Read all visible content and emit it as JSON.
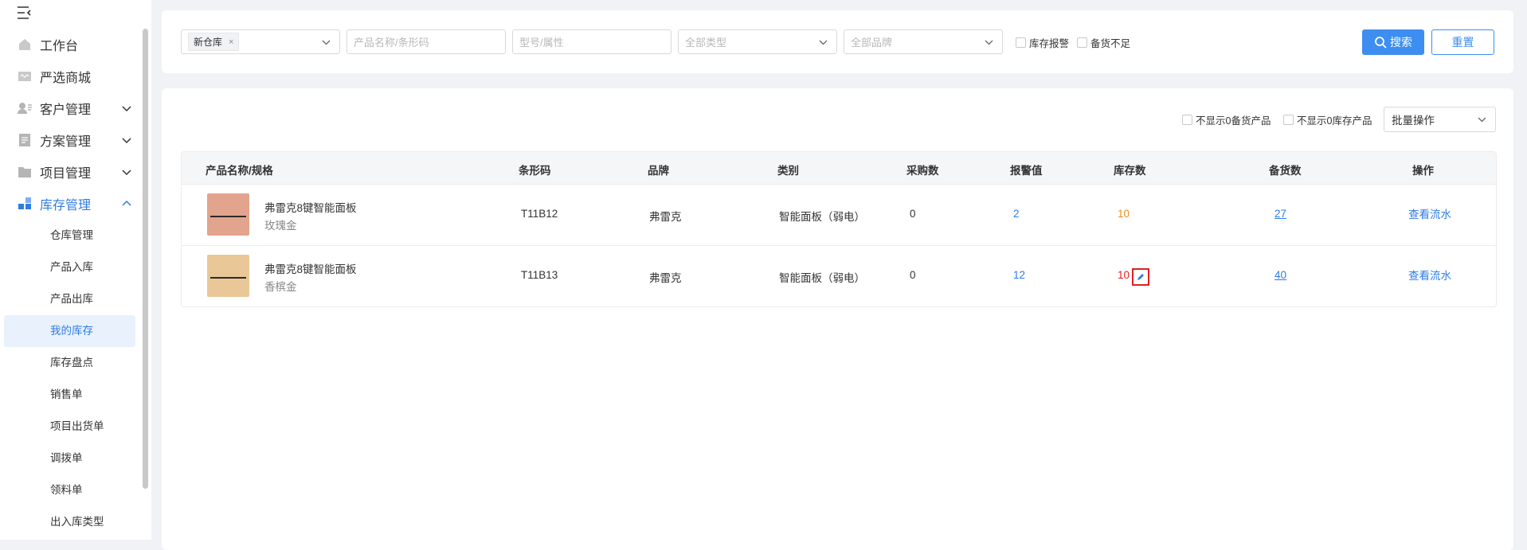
{
  "sidebar": {
    "menu": [
      {
        "label": "工作台",
        "icon": "home-icon"
      },
      {
        "label": "严选商城",
        "icon": "mall-icon"
      },
      {
        "label": "客户管理",
        "icon": "customer-icon"
      },
      {
        "label": "方案管理",
        "icon": "plan-icon"
      },
      {
        "label": "项目管理",
        "icon": "folder-icon"
      },
      {
        "label": "库存管理",
        "icon": "inventory-icon"
      }
    ],
    "sub_items": [
      "仓库管理",
      "产品入库",
      "产品出库",
      "我的库存",
      "库存盘点",
      "销售单",
      "项目出货单",
      "调拨单",
      "领料单",
      "出入库类型"
    ]
  },
  "filters": {
    "warehouse_tag": "新仓库",
    "warehouse_tag_close": "×",
    "name_placeholder": "产品名称/条形码",
    "model_placeholder": "型号/属性",
    "type_placeholder": "全部类型",
    "brand_placeholder": "全部品牌",
    "check_alarm": "库存报警",
    "check_shortage": "备货不足",
    "search_label": "搜索",
    "reset_label": "重置"
  },
  "toolbar": {
    "hide_zero_stockup": "不显示0备货产品",
    "hide_zero_stock": "不显示0库存产品",
    "bulk_label": "批量操作"
  },
  "table": {
    "headers": [
      "产品名称/规格",
      "条形码",
      "品牌",
      "类别",
      "采购数",
      "报警值",
      "库存数",
      "备货数",
      "操作"
    ],
    "rows": [
      {
        "name": "弗雷克8键智能面板",
        "spec": "玫瑰金",
        "barcode": "T11B12",
        "brand": "弗雷克",
        "category": "智能面板（弱电）",
        "purchase": "0",
        "alarm": "2",
        "stock": "10",
        "stockup": "27",
        "action": "查看流水",
        "thumb_color": "#e2a48c"
      },
      {
        "name": "弗雷克8键智能面板",
        "spec": "香槟金",
        "barcode": "T11B13",
        "brand": "弗雷克",
        "category": "智能面板（弱电）",
        "purchase": "0",
        "alarm": "12",
        "stock": "10",
        "stockup": "40",
        "action": "查看流水",
        "thumb_color": "#e9c796"
      }
    ]
  },
  "colors": {
    "accent": "#2f7ce6",
    "button": "#3d8ef0",
    "warning": "#f08a24",
    "danger": "#e02020"
  }
}
